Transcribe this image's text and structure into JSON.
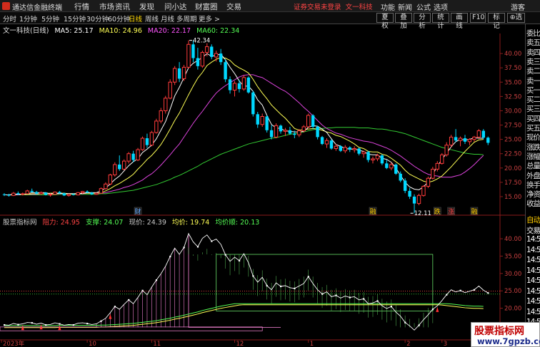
{
  "titlebar": {
    "app_name": "通达信金融终端",
    "menu": [
      "行情",
      "市场",
      "资讯",
      "发现",
      "问小达",
      "财富圈",
      "交易"
    ],
    "notice": "证券交易未登录",
    "stock_link": "文一科技",
    "right_items": [
      "功能",
      "新闻",
      "公式",
      "选项",
      "游客"
    ]
  },
  "toolbar": {
    "periods": [
      "分时",
      "1分钟",
      "5分钟",
      "15分钟",
      "30分钟",
      "60分钟",
      "日线",
      "周线",
      "月线",
      "多周期",
      "更多"
    ],
    "active_period": "日线",
    "right_buttons": [
      "夏权",
      "叠加",
      "分析",
      "统计",
      "画线",
      "F10",
      "标记",
      "⊕选"
    ]
  },
  "main_chart": {
    "stock_title": "文一科技(日线)",
    "ma_labels": [
      {
        "text": "MA5: 25.17",
        "color": "#ffffff"
      },
      {
        "text": "MA10: 24.96",
        "color": "#ffff55"
      },
      {
        "text": "MA20: 22.17",
        "color": "#ff55ff"
      },
      {
        "text": "MA60: 22.34",
        "color": "#55ff55"
      }
    ],
    "high_label": "42.34",
    "low_label": "12.11",
    "y_ticks": [
      "40.00",
      "37.50",
      "35.00",
      "32.50",
      "30.00",
      "27.50",
      "25.00",
      "22.50",
      "20.00",
      "17.50",
      "15.00"
    ],
    "markers": [
      {
        "text": "财",
        "color": "#66aaff"
      },
      {
        "text": "融",
        "color": "#ffcc00"
      },
      {
        "text": "跌",
        "color": "#ffcc00"
      },
      {
        "text": "涨",
        "color": "#ff4444"
      },
      {
        "text": "融",
        "color": "#ffcc00"
      }
    ]
  },
  "indicator": {
    "name": "股票指标网",
    "fields": [
      {
        "text": "阻力: 24.95",
        "color": "#ff4444"
      },
      {
        "text": "支撑: 24.07",
        "color": "#55ff55"
      },
      {
        "text": "现价: 24.39",
        "color": "#c8c8c8"
      },
      {
        "text": "均价: 19.74",
        "color": "#ffff55"
      },
      {
        "text": "均价顺: 20.13",
        "color": "#55ff55"
      }
    ],
    "y_ticks": [
      "40.00",
      "35.00",
      "30.00",
      "25.00",
      "20.00"
    ]
  },
  "xaxis": {
    "labels": [
      "2023年",
      "10",
      "11",
      "12",
      "1",
      "2",
      "3"
    ]
  },
  "sidebar": {
    "quote_items": [
      "委比",
      "卖五",
      "卖四",
      "卖三",
      "卖二",
      "卖一",
      "买一",
      "买二",
      "买三",
      "买四",
      "买五",
      "现价",
      "涨跌",
      "涨幅",
      "总量",
      "外盘",
      "换手",
      "净资",
      "收益"
    ],
    "tick_items": [
      "自动",
      "交易",
      "14:5",
      "14:5",
      "14:5",
      "14:5",
      "14:5",
      "14:5",
      "14:5",
      "14:5",
      "14:5",
      "14:5"
    ]
  },
  "watermark": {
    "title": "股票指标网",
    "url": "www.7gpzb.com"
  },
  "colors": {
    "up": "#ff3b3b",
    "down": "#00d8ff",
    "ma5": "#ffffff",
    "ma10": "#ffff55",
    "ma20": "#dd44dd",
    "ma60": "#33cc33"
  },
  "chart_data": {
    "type": "candlestick",
    "y_range": [
      13.5,
      43.5
    ],
    "ohlc": [
      [
        15.4,
        15.6,
        15.1,
        15.3
      ],
      [
        15.3,
        15.5,
        15.0,
        15.2
      ],
      [
        15.2,
        15.8,
        15.1,
        15.6
      ],
      [
        15.6,
        15.9,
        15.3,
        15.4
      ],
      [
        15.4,
        15.7,
        15.2,
        15.5
      ],
      [
        15.5,
        16.2,
        15.4,
        16.0
      ],
      [
        16.0,
        16.4,
        15.7,
        15.8
      ],
      [
        15.8,
        16.0,
        15.4,
        15.5
      ],
      [
        15.5,
        15.9,
        15.3,
        15.7
      ],
      [
        15.7,
        15.8,
        15.2,
        15.3
      ],
      [
        15.3,
        15.6,
        15.0,
        15.4
      ],
      [
        15.4,
        15.9,
        15.3,
        15.8
      ],
      [
        15.8,
        16.0,
        15.5,
        15.6
      ],
      [
        15.6,
        15.7,
        15.1,
        15.2
      ],
      [
        15.2,
        15.5,
        15.0,
        15.4
      ],
      [
        15.4,
        15.6,
        15.2,
        15.3
      ],
      [
        15.3,
        15.8,
        15.2,
        15.7
      ],
      [
        15.7,
        16.0,
        15.5,
        15.9
      ],
      [
        15.9,
        16.1,
        15.6,
        15.7
      ],
      [
        15.7,
        15.8,
        15.3,
        15.4
      ],
      [
        15.4,
        15.7,
        15.3,
        15.6
      ],
      [
        15.6,
        16.6,
        15.5,
        16.4
      ],
      [
        16.4,
        17.5,
        16.2,
        17.2
      ],
      [
        17.2,
        19.0,
        17.0,
        18.8
      ],
      [
        18.8,
        21.0,
        18.5,
        20.6
      ],
      [
        20.6,
        22.2,
        19.5,
        19.8
      ],
      [
        19.8,
        21.5,
        19.6,
        21.2
      ],
      [
        21.2,
        22.8,
        20.8,
        22.5
      ],
      [
        22.5,
        23.0,
        21.0,
        21.4
      ],
      [
        21.4,
        23.5,
        21.2,
        23.2
      ],
      [
        23.2,
        25.5,
        23.0,
        25.2
      ],
      [
        25.2,
        26.0,
        23.5,
        24.0
      ],
      [
        24.0,
        26.5,
        23.8,
        26.2
      ],
      [
        26.2,
        28.6,
        26.0,
        28.2
      ],
      [
        28.2,
        30.5,
        27.8,
        30.0
      ],
      [
        30.0,
        32.6,
        29.5,
        32.2
      ],
      [
        32.2,
        35.5,
        32.0,
        35.0
      ],
      [
        35.0,
        37.8,
        34.5,
        37.4
      ],
      [
        37.4,
        38.5,
        35.0,
        35.6
      ],
      [
        35.6,
        38.0,
        35.2,
        37.6
      ],
      [
        37.6,
        42.3,
        37.4,
        41.6
      ],
      [
        41.6,
        42.3,
        38.5,
        39.2
      ],
      [
        39.2,
        41.0,
        37.2,
        37.8
      ],
      [
        37.8,
        40.5,
        37.5,
        40.2
      ],
      [
        40.2,
        41.8,
        39.5,
        41.2
      ],
      [
        41.2,
        41.6,
        39.0,
        39.4
      ],
      [
        39.4,
        40.5,
        38.6,
        40.0
      ],
      [
        40.0,
        40.8,
        38.0,
        38.5
      ],
      [
        38.5,
        39.0,
        35.0,
        35.5
      ],
      [
        35.5,
        36.0,
        33.0,
        33.6
      ],
      [
        33.6,
        35.2,
        32.5,
        34.8
      ],
      [
        34.8,
        35.4,
        33.2,
        33.8
      ],
      [
        33.8,
        36.2,
        33.5,
        35.8
      ],
      [
        35.8,
        36.0,
        33.0,
        33.2
      ],
      [
        33.2,
        33.5,
        29.0,
        29.4
      ],
      [
        29.4,
        29.8,
        27.0,
        27.6
      ],
      [
        27.6,
        29.5,
        27.2,
        29.0
      ],
      [
        29.0,
        29.2,
        26.2,
        26.6
      ],
      [
        26.6,
        27.5,
        25.0,
        25.4
      ],
      [
        25.4,
        27.8,
        25.2,
        27.4
      ],
      [
        27.4,
        27.6,
        26.0,
        26.4
      ],
      [
        26.4,
        27.0,
        25.6,
        26.6
      ],
      [
        26.6,
        27.2,
        25.8,
        26.0
      ],
      [
        26.0,
        26.5,
        25.2,
        25.8
      ],
      [
        25.8,
        26.8,
        25.4,
        26.5
      ],
      [
        26.5,
        27.5,
        26.2,
        27.2
      ],
      [
        27.2,
        29.5,
        27.0,
        29.2
      ],
      [
        29.2,
        29.4,
        26.8,
        27.2
      ],
      [
        27.2,
        27.4,
        25.0,
        25.4
      ],
      [
        25.4,
        25.6,
        24.0,
        24.2
      ],
      [
        24.2,
        25.2,
        23.5,
        24.8
      ],
      [
        24.8,
        25.0,
        23.2,
        23.4
      ],
      [
        23.4,
        24.2,
        23.0,
        23.8
      ],
      [
        23.8,
        24.0,
        22.8,
        23.0
      ],
      [
        23.0,
        24.0,
        22.6,
        23.6
      ],
      [
        23.6,
        23.8,
        22.8,
        23.2
      ],
      [
        23.2,
        23.8,
        22.7,
        23.4
      ],
      [
        23.4,
        23.5,
        22.2,
        22.5
      ],
      [
        22.5,
        23.0,
        21.8,
        22.8
      ],
      [
        22.8,
        23.0,
        21.0,
        21.4
      ],
      [
        21.4,
        22.0,
        20.8,
        21.6
      ],
      [
        21.6,
        22.5,
        21.2,
        22.2
      ],
      [
        22.2,
        22.4,
        20.5,
        20.8
      ],
      [
        20.8,
        21.4,
        19.8,
        20.0
      ],
      [
        20.0,
        21.0,
        19.6,
        20.6
      ],
      [
        20.6,
        20.8,
        18.8,
        19.0
      ],
      [
        19.0,
        19.4,
        17.5,
        17.8
      ],
      [
        17.8,
        18.2,
        15.6,
        16.0
      ],
      [
        16.0,
        16.5,
        14.6,
        15.0
      ],
      [
        15.0,
        15.4,
        12.1,
        13.8
      ],
      [
        13.8,
        15.5,
        13.5,
        15.2
      ],
      [
        15.2,
        17.0,
        15.0,
        16.8
      ],
      [
        16.8,
        18.5,
        16.5,
        18.2
      ],
      [
        18.2,
        20.2,
        18.0,
        19.8
      ],
      [
        19.8,
        21.2,
        19.4,
        20.8
      ],
      [
        20.8,
        22.6,
        20.6,
        22.3
      ],
      [
        22.3,
        24.5,
        22.0,
        24.0
      ],
      [
        24.0,
        25.8,
        23.6,
        25.4
      ],
      [
        25.4,
        26.8,
        24.5,
        24.8
      ],
      [
        24.8,
        25.5,
        23.8,
        25.2
      ],
      [
        25.2,
        25.8,
        24.2,
        24.6
      ],
      [
        24.6,
        25.2,
        24.0,
        25.0
      ],
      [
        25.0,
        25.6,
        24.6,
        25.4
      ],
      [
        25.4,
        26.8,
        25.2,
        26.5
      ],
      [
        26.5,
        26.8,
        25.0,
        25.3
      ],
      [
        25.3,
        25.5,
        24.0,
        24.4
      ]
    ],
    "ma5": [
      15.3,
      15.3,
      15.4,
      15.4,
      15.4,
      15.5,
      15.7,
      15.7,
      15.7,
      15.7,
      15.5,
      15.5,
      15.6,
      15.5,
      15.5,
      15.5,
      15.5,
      15.6,
      15.7,
      15.7,
      15.7,
      16.0,
      16.5,
      17.2,
      18.0,
      18.6,
      19.5,
      20.4,
      21.1,
      21.6,
      22.7,
      23.3,
      24.0,
      25.1,
      26.6,
      28.1,
      30.3,
      32.6,
      34.1,
      35.8,
      37.5,
      38.3,
      38.8,
      39.3,
      40.0,
      39.5,
      39.7,
      39.9,
      38.9,
      37.6,
      36.5,
      35.2,
      34.3,
      34.3,
      33.4,
      31.9,
      31.0,
      29.2,
      27.6,
      27.0,
      26.9,
      26.5,
      26.4,
      26.3,
      26.3,
      26.4,
      27.1,
      27.4,
      27.3,
      26.8,
      26.2,
      25.1,
      24.1,
      23.8,
      23.4,
      23.3,
      23.3,
      23.1,
      22.9,
      22.4,
      22.3,
      22.3,
      21.7,
      21.5,
      21.0,
      20.0,
      18.7,
      17.5,
      16.7,
      16.3,
      16.2,
      16.7,
      17.6,
      18.9,
      20.3,
      21.5,
      22.6,
      23.7,
      24.6,
      25.0,
      24.9,
      25.0,
      25.3,
      25.2,
      25.2
    ],
    "ma10": [
      15.3,
      15.3,
      15.3,
      15.4,
      15.4,
      15.4,
      15.5,
      15.5,
      15.5,
      15.5,
      15.6,
      15.6,
      15.6,
      15.6,
      15.5,
      15.5,
      15.5,
      15.6,
      15.6,
      15.6,
      15.6,
      15.7,
      16.0,
      16.4,
      16.9,
      17.3,
      17.8,
      18.3,
      18.9,
      19.8,
      20.6,
      21.5,
      22.2,
      23.1,
      24.1,
      25.4,
      26.8,
      28.3,
      29.6,
      31.2,
      32.8,
      34.3,
      35.7,
      36.7,
      37.9,
      38.5,
      39.0,
      39.3,
      39.2,
      38.8,
      38.0,
      37.5,
      37.1,
      36.6,
      35.5,
      34.2,
      33.1,
      32.1,
      31.0,
      30.2,
      29.4,
      28.7,
      27.8,
      26.9,
      26.6,
      26.7,
      26.8,
      26.9,
      26.8,
      26.6,
      26.3,
      26.1,
      25.7,
      25.5,
      25.1,
      24.7,
      24.2,
      23.6,
      23.4,
      22.9,
      22.8,
      22.8,
      22.4,
      22.2,
      21.7,
      21.1,
      20.5,
      19.6,
      18.9,
      18.5,
      18.1,
      17.7,
      17.5,
      17.7,
      18.1,
      18.6,
      19.4,
      20.2,
      21.1,
      22.0,
      22.9,
      23.7,
      24.5,
      24.9,
      25.0
    ],
    "ma20": [
      15.3,
      15.3,
      15.3,
      15.3,
      15.4,
      15.4,
      15.4,
      15.4,
      15.5,
      15.5,
      15.5,
      15.5,
      15.5,
      15.5,
      15.5,
      15.5,
      15.5,
      15.5,
      15.6,
      15.6,
      15.6,
      15.6,
      15.7,
      15.9,
      16.1,
      16.3,
      16.6,
      16.8,
      17.1,
      17.5,
      17.9,
      18.5,
      19.0,
      19.7,
      20.5,
      21.4,
      22.3,
      23.3,
      24.2,
      25.4,
      26.6,
      27.8,
      28.9,
      29.9,
      31.0,
      32.1,
      33.1,
      33.8,
      34.4,
      34.9,
      35.4,
      35.9,
      36.2,
      36.3,
      36.3,
      36.0,
      35.8,
      35.3,
      34.8,
      34.3,
      33.8,
      33.4,
      32.8,
      32.1,
      31.4,
      30.6,
      29.9,
      29.1,
      28.3,
      27.5,
      26.9,
      26.5,
      26.1,
      25.9,
      25.6,
      25.3,
      25.1,
      24.9,
      24.7,
      24.6,
      24.4,
      24.1,
      23.8,
      23.5,
      23.1,
      22.6,
      22.1,
      21.5,
      20.9,
      20.3,
      19.8,
      19.3,
      18.9,
      18.7,
      18.6,
      18.4,
      18.4,
      18.4,
      18.6,
      18.8,
      19.3,
      19.9,
      20.6,
      21.4,
      22.2
    ],
    "ma60": [
      15.3,
      15.3,
      15.3,
      15.3,
      15.3,
      15.3,
      15.3,
      15.3,
      15.3,
      15.3,
      15.3,
      15.3,
      15.4,
      15.4,
      15.4,
      15.4,
      15.4,
      15.4,
      15.4,
      15.4,
      15.4,
      15.5,
      15.5,
      15.6,
      15.7,
      15.8,
      15.9,
      16.0,
      16.1,
      16.3,
      16.5,
      16.7,
      16.9,
      17.1,
      17.4,
      17.7,
      18.0,
      18.4,
      18.7,
      19.1,
      19.5,
      19.9,
      20.3,
      20.8,
      21.2,
      21.6,
      22.0,
      22.4,
      22.7,
      23.0,
      23.3,
      23.6,
      23.9,
      24.2,
      24.4,
      24.6,
      24.8,
      25.0,
      25.2,
      25.3,
      25.5,
      25.7,
      25.9,
      26.0,
      26.1,
      26.3,
      26.5,
      26.7,
      26.8,
      26.9,
      27.0,
      27.0,
      27.1,
      27.1,
      27.1,
      27.1,
      27.1,
      27.0,
      27.0,
      27.0,
      26.9,
      26.8,
      26.8,
      26.7,
      26.5,
      26.4,
      26.2,
      26.0,
      25.7,
      25.4,
      25.1,
      24.8,
      24.5,
      24.2,
      23.9,
      23.6,
      23.4,
      23.2,
      23.0,
      22.8,
      22.6,
      22.5,
      22.4,
      22.4,
      22.3
    ],
    "indicator_range": [
      11.5,
      43.5
    ],
    "price_line": [
      15.2,
      15.1,
      15.6,
      15.3,
      15.5,
      15.9,
      15.8,
      15.4,
      15.7,
      15.2,
      15.3,
      15.8,
      15.5,
      15.1,
      15.3,
      15.2,
      15.7,
      15.8,
      15.6,
      15.3,
      15.5,
      16.3,
      17.1,
      18.7,
      20.5,
      19.7,
      21.1,
      22.4,
      21.3,
      23.1,
      25.1,
      23.9,
      26.1,
      28.1,
      29.9,
      32.1,
      34.9,
      37.3,
      35.5,
      37.5,
      41.5,
      39.1,
      37.7,
      40.1,
      41.1,
      39.3,
      39.9,
      38.4,
      35.4,
      33.5,
      34.7,
      33.7,
      35.7,
      33.1,
      29.3,
      27.5,
      28.9,
      26.5,
      25.3,
      27.3,
      26.3,
      26.5,
      25.9,
      25.7,
      26.4,
      27.1,
      29.1,
      27.1,
      25.3,
      24.1,
      24.7,
      23.3,
      23.7,
      22.9,
      23.5,
      23.1,
      23.3,
      22.4,
      22.7,
      21.3,
      21.5,
      22.1,
      20.7,
      19.9,
      20.5,
      18.9,
      17.7,
      15.9,
      14.9,
      13.7,
      15.1,
      16.7,
      18.1,
      19.7,
      20.7,
      22.2,
      23.9,
      25.3,
      24.7,
      25.1,
      24.5,
      24.9,
      25.3,
      26.4,
      25.2,
      24.4
    ]
  }
}
